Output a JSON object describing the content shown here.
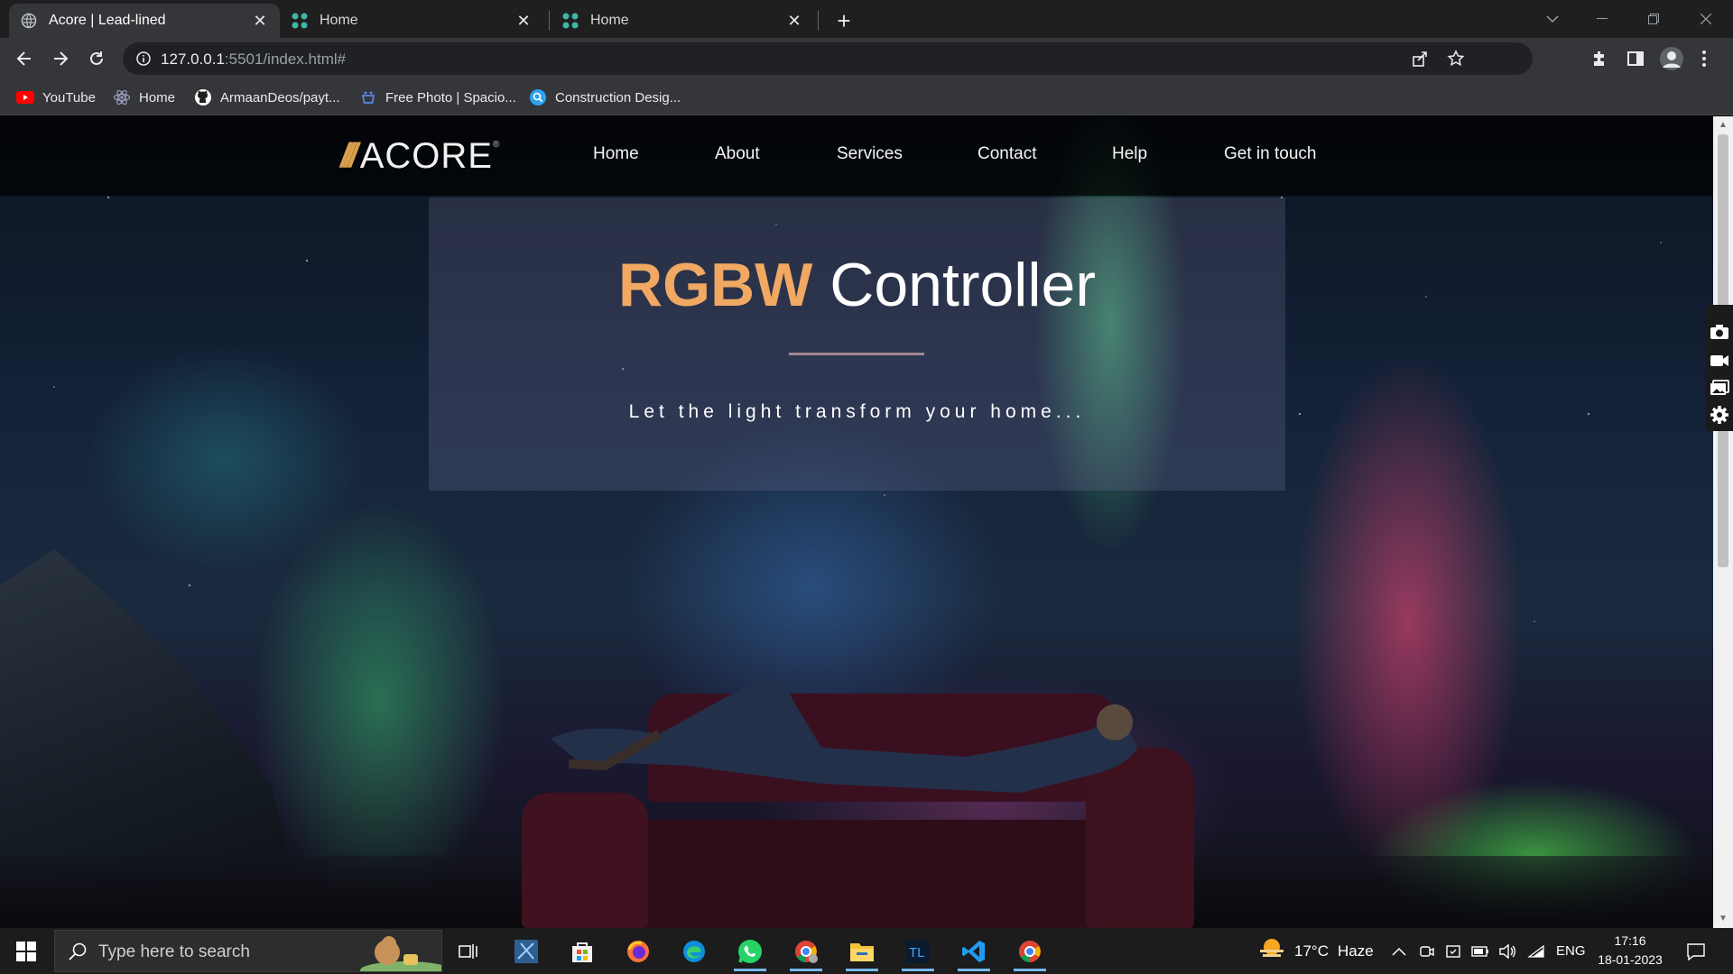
{
  "browser": {
    "tabs": [
      {
        "title": "Acore | Lead-lined",
        "active": true
      },
      {
        "title": "Home",
        "active": false
      },
      {
        "title": "Home",
        "active": false
      }
    ],
    "new_tab_label": "+",
    "url_host": "127.0.0.1",
    "url_rest": ":5501/index.html#",
    "bookmarks": [
      {
        "label": "YouTube",
        "icon": "youtube-icon"
      },
      {
        "label": "Home",
        "icon": "react-icon"
      },
      {
        "label": "ArmaanDeos/payt...",
        "icon": "github-icon"
      },
      {
        "label": "Free Photo | Spacio...",
        "icon": "freepik-icon"
      },
      {
        "label": "Construction Desig...",
        "icon": "search-bubble-icon"
      }
    ]
  },
  "site": {
    "logo_slashes": "///",
    "logo_text": "ACORE",
    "logo_reg": "®",
    "nav": [
      "Home",
      "About",
      "Services",
      "Contact",
      "Help",
      "Get in touch"
    ],
    "hero": {
      "title_accent": "RGBW",
      "title_rest": " Controller",
      "tagline": "Let the light transform your home..."
    }
  },
  "taskbar": {
    "search_placeholder": "Type here to search",
    "weather_temp": "17°C",
    "weather_desc": "Haze",
    "language": "ENG",
    "time": "17:16",
    "date": "18-01-2023",
    "apps": [
      "task-view-icon",
      "snipping-tool-icon",
      "microsoft-store-icon",
      "firefox-icon",
      "edge-icon",
      "whatsapp-icon",
      "chrome-profile-icon",
      "file-explorer-icon",
      "tl-app-icon",
      "vscode-icon",
      "chrome-icon"
    ]
  },
  "colors": {
    "accent": "#f0a862",
    "logo_slash": "#d9a14d",
    "chrome_dark": "#35363a",
    "taskbar": "#1c1c1c"
  }
}
